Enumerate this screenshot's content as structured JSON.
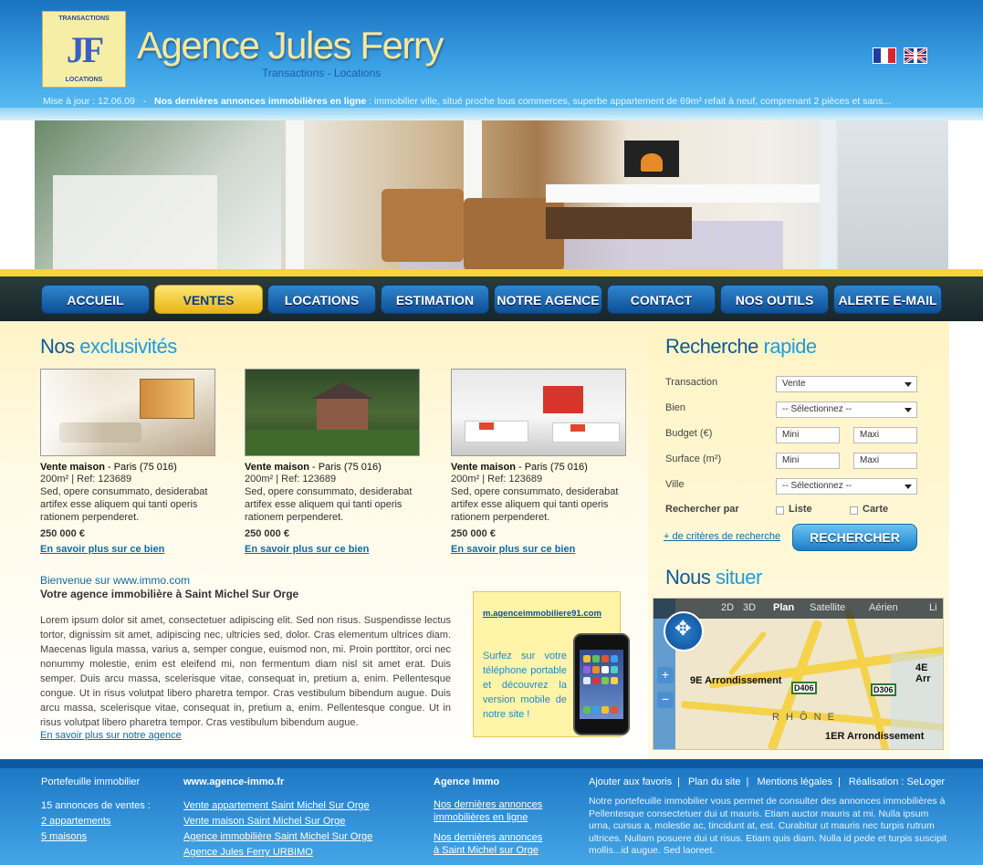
{
  "header": {
    "logo_top": "TRANSACTIONS",
    "logo_letters": "JF",
    "logo_bottom": "LOCATIONS",
    "agency_name": "Agence Jules Ferry",
    "agency_sub": "Transactions - Locations",
    "update_label": "Mise à jour : 12.06.09",
    "ticker_sep": "-",
    "ticker_title": "Nos dernières annonces immobilières en ligne",
    "ticker_text": ": immobilier ville, situé proche tous commerces, superbe appartement de 69m² refait à neuf, comprenant 2 pièces et sans...",
    "flags": [
      "fr-flag-icon",
      "uk-flag-icon"
    ]
  },
  "nav": {
    "items": [
      "ACCUEIL",
      "VENTES",
      "LOCATIONS",
      "ESTIMATION",
      "NOTRE AGENCE",
      "CONTACT",
      "NOS OUTILS",
      "ALERTE E-MAIL"
    ],
    "active_index": 1
  },
  "exclusives": {
    "title_a": "Nos",
    "title_b": "exclusivités",
    "items": [
      {
        "type": "Vente maison",
        "loc": " - Paris (75 016)",
        "meta": "200m² | Ref: 123689",
        "desc": "Sed, opere consummato, desiderabat artifex esse aliquem qui tanti operis rationem perpenderet.",
        "price": "250 000 €",
        "link": "En savoir plus sur ce bien"
      },
      {
        "type": "Vente maison",
        "loc": " - Paris (75 016)",
        "meta": "200m² | Ref: 123689",
        "desc": "Sed, opere consummato, desiderabat artifex esse aliquem qui tanti operis rationem perpenderet.",
        "price": "250 000 €",
        "link": "En savoir plus sur ce bien"
      },
      {
        "type": "Vente maison",
        "loc": " - Paris (75 016)",
        "meta": "200m² | Ref: 123689",
        "desc": "Sed, opere consummato, desiderabat artifex esse aliquem qui tanti operis rationem perpenderet.",
        "price": "250 000 €",
        "link": "En savoir plus sur ce bien"
      }
    ]
  },
  "welcome": {
    "title": "Bienvenue sur www.immo.com",
    "subtitle": "Votre agence immobilière à Saint Michel Sur Orge",
    "body": "Lorem ipsum dolor sit amet, consectetuer adipiscing elit. Sed non risus. Suspendisse lectus tortor, dignissim sit amet, adipiscing nec, ultricies sed, dolor. Cras elementum ultrices diam. Maecenas ligula massa, varius a, semper congue, euismod non, mi. Proin porttitor, orci nec nonummy molestie, enim est eleifend mi, non fermentum diam nisl sit amet erat. Duis semper. Duis arcu massa, scelerisque vitae, consequat in, pretium a, enim. Pellentesque congue. Ut in risus volutpat libero pharetra tempor. Cras vestibulum bibendum augue. Duis arcu massa, scelerisque vitae, consequat in, pretium a, enim. Pellentesque congue. Ut in risus volutpat libero pharetra tempor. Cras vestibulum bibendum augue.",
    "link": "En savoir plus sur notre agence"
  },
  "mobile": {
    "url": "m.agenceimmobiliere91.com",
    "text": "Surfez sur votre téléphone portable et découvrez la version mobile de notre site !"
  },
  "search": {
    "title_a": "Recherche",
    "title_b": "rapide",
    "labels": {
      "transaction": "Transaction",
      "bien": "Bien",
      "budget": "Budget (€)",
      "surface": "Surface (m²)",
      "ville": "Ville",
      "by": "Rechercher par"
    },
    "transaction_value": "Vente",
    "bien_value": "-- Sélectionnez --",
    "ville_value": "-- Sélectionnez --",
    "min_placeholder": "Mini",
    "max_placeholder": "Maxi",
    "opt_list": "Liste",
    "opt_map": "Carte",
    "more": "+ de critères de recherche",
    "button": "RECHERCHER"
  },
  "locate": {
    "title_a": "Nous",
    "title_b": "situer",
    "tabs": [
      "2D",
      "3D",
      "Plan",
      "Satellite",
      "Aérien",
      "Li"
    ],
    "selected_tab": "Plan",
    "labels": [
      "9E Arrondissement",
      "4E Arr",
      "1ER Arrondissement",
      "R H Ô N E"
    ],
    "signs": [
      "D406",
      "D306"
    ],
    "zoom_in": "+",
    "zoom_out": "−"
  },
  "footer": {
    "col1_title": "Portefeuille immobilier",
    "col1_line": "15 annonces de ventes :",
    "col1_links": [
      "2 appartements",
      "5 maisons"
    ],
    "col2_title": "www.agence-immo.fr",
    "col2_links": [
      "Vente appartement Saint Michel Sur Orge",
      "Vente maison Saint Michel Sur Orge",
      "Agence immobilière Saint Michel Sur Orge",
      "Agence Jules Ferry URBIMO"
    ],
    "col3_title": "Agence Immo",
    "col3_link1": "Nos dernières annonces immobilières en ligne",
    "col3_link2": "Nos dernières annonces à Saint Michel sur Orge",
    "top_links": [
      "Ajouter aux favoris",
      "Plan du site",
      "Mentions légales",
      "Réalisation : SeLoger"
    ],
    "text": "Notre portefeuille immobilier vous permet de consulter des annonces immobilières à Pellentesque consectetuer dui ut mauris. Etiam auctor mauris at mi. Nulla ipsum urna, cursus a, molestie ac, tincidunt at, est. Curabitur ut mauris nec turpis rutrum ultrices. Nullam posuere dui ut risus. Etiam quis diam. Nulla id pede et turpis suscipit mollis...id augue. Sed laoreet."
  },
  "colors": {
    "brand_blue": "#1a73c0",
    "accent_yellow": "#f7d438",
    "nav_blue": "#0e4f94"
  }
}
